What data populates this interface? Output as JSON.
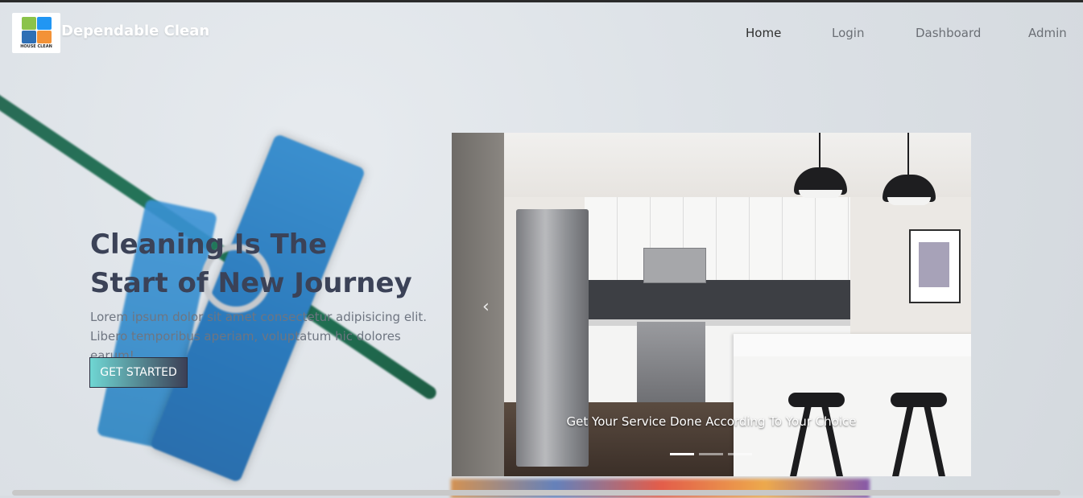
{
  "brand": {
    "name": "Dependable Clean",
    "logo_text": "HOUSE CLEAN"
  },
  "nav": {
    "items": [
      "Home",
      "Login",
      "Dashboard",
      "Admin"
    ],
    "active": "Home"
  },
  "hero": {
    "title_line1": "Cleaning Is The",
    "title_line2": "Start of New Journey",
    "subtitle_line1": "Lorem ipsum dolor sit amet consectetur adipisicing elit.",
    "subtitle_line2": "Libero temporibus aperiam, voluptatum hic dolores earum!",
    "cta": "GET STARTED"
  },
  "carousel": {
    "caption": "Get Your Service Done According To Your Choice",
    "prev_icon": "chevron-left-icon",
    "slide_count": 3,
    "active_slide": 1
  },
  "colors": {
    "title": "#3b4257",
    "subtitle": "#6e7581",
    "cta_gradient_start": "#6fd6d3",
    "cta_gradient_end": "#3c3f55",
    "nav_active": "#2f2f2f",
    "nav_inactive": "#6b6f75"
  }
}
